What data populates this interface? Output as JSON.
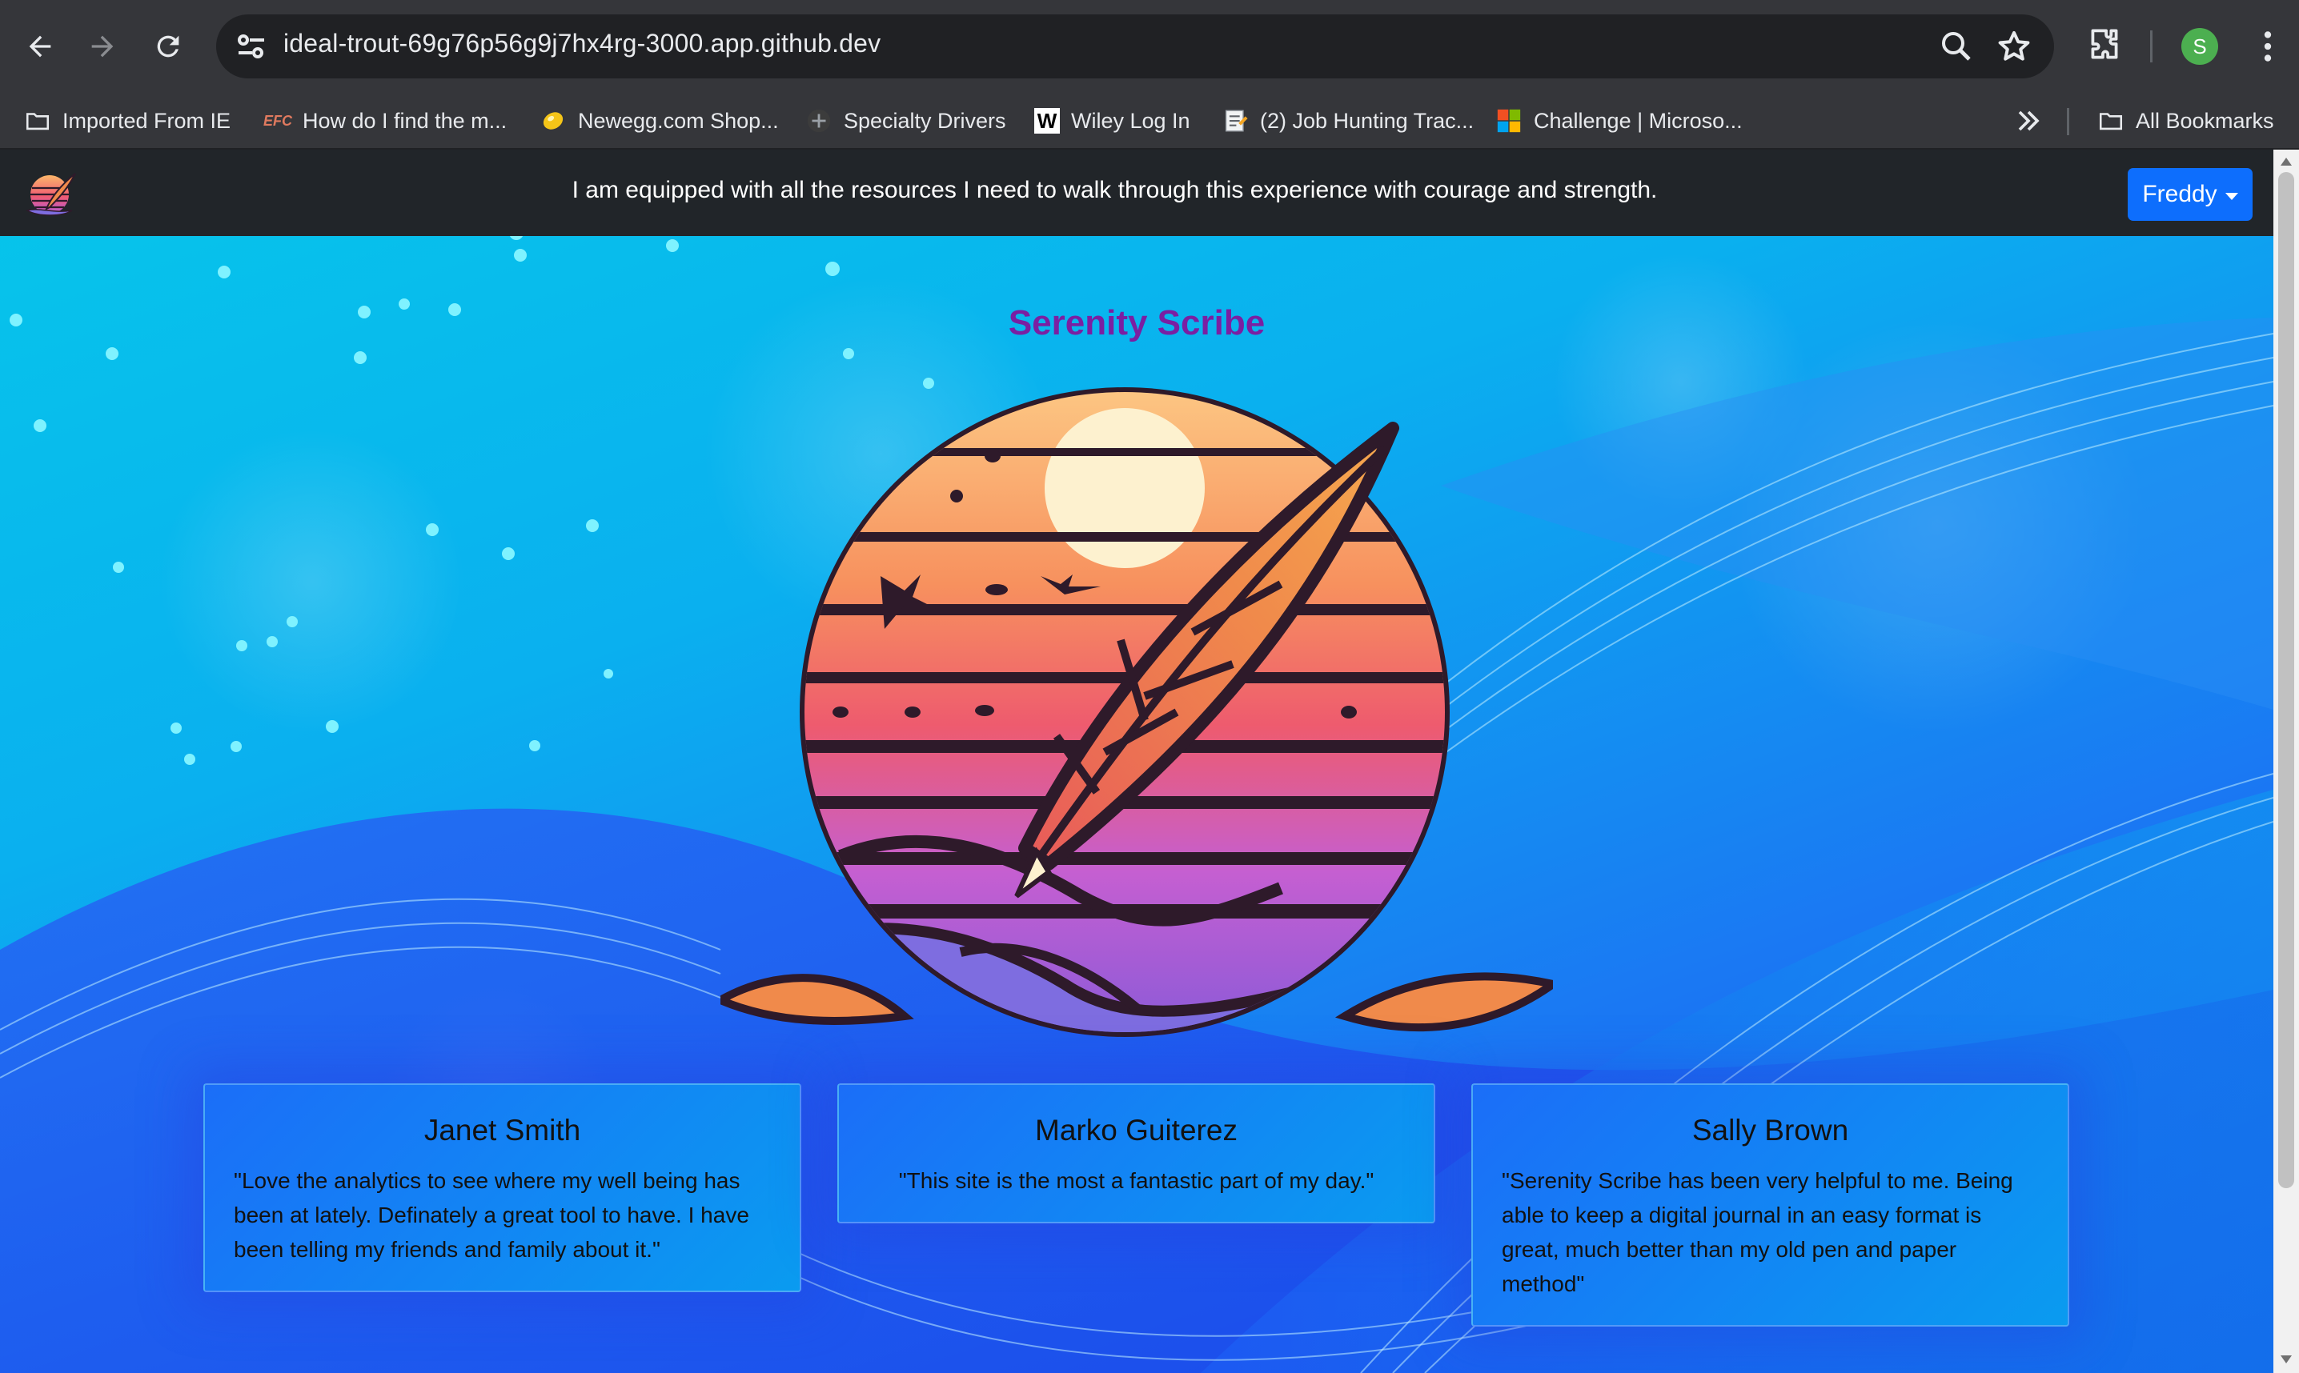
{
  "browser": {
    "url": "ideal-trout-69g76p56g9j7hx4rg-3000.app.github.dev",
    "profile_initial": "S",
    "profile_color": "#4caf50",
    "bookmarks": [
      {
        "label": "Imported From IE",
        "icon": "folder-icon"
      },
      {
        "label": "How do I find the m...",
        "icon": "efc-favicon"
      },
      {
        "label": "Newegg.com Shop...",
        "icon": "newegg-favicon"
      },
      {
        "label": "Specialty Drivers",
        "icon": "drivers-favicon"
      },
      {
        "label": "Wiley Log In",
        "icon": "wiley-favicon"
      },
      {
        "label": "(2) Job Hunting Trac...",
        "icon": "notepad-favicon"
      },
      {
        "label": "Challenge | Microso...",
        "icon": "microsoft-favicon"
      }
    ],
    "all_bookmarks_label": "All Bookmarks"
  },
  "navbar": {
    "quote": "I am equipped with all the resources I need to walk through this experience with courage and strength.",
    "user_button": "Freddy",
    "accent": "#0d6efd"
  },
  "hero": {
    "title": "Serenity Scribe",
    "title_color": "#7b1fa2"
  },
  "testimonials": [
    {
      "name": "Janet Smith",
      "text": "\"Love the analytics to see where my well being has been at lately. Definately a great tool to have. I have been telling my friends and family about it.\""
    },
    {
      "name": "Marko Guiterez",
      "text": "\"This site is the most a fantastic part of my day.\""
    },
    {
      "name": "Sally Brown",
      "text": "\"Serenity Scribe has been very helpful to me. Being able to keep a digital journal in an easy format is great, much better than my old pen and paper method\""
    }
  ]
}
